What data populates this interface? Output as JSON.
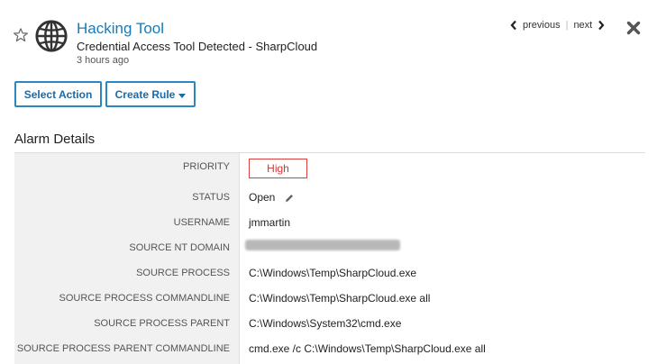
{
  "header": {
    "title": "Hacking Tool",
    "subtitle": "Credential Access Tool Detected - SharpCloud",
    "time_ago": "3 hours ago"
  },
  "nav": {
    "previous_label": "previous",
    "separator": "|",
    "next_label": "next"
  },
  "actions": {
    "select_action_label": "Select Action",
    "create_rule_label": "Create Rule"
  },
  "details": {
    "section_title": "Alarm Details",
    "priority_label": "PRIORITY",
    "priority_value": "High",
    "status_label": "STATUS",
    "status_value": "Open",
    "username_label": "USERNAME",
    "username_value": "jmmartin",
    "source_nt_domain_label": "SOURCE NT DOMAIN",
    "source_process_label": "SOURCE PROCESS",
    "source_process_value": "C:\\Windows\\Temp\\SharpCloud.exe",
    "source_process_cmdline_label": "SOURCE PROCESS COMMANDLINE",
    "source_process_cmdline_value": "C:\\Windows\\Temp\\SharpCloud.exe all",
    "source_process_parent_label": "SOURCE PROCESS PARENT",
    "source_process_parent_value": "C:\\Windows\\System32\\cmd.exe",
    "source_process_parent_cmdline_label": "SOURCE PROCESS PARENT COMMANDLINE",
    "source_process_parent_cmdline_value": "cmd.exe /c C:\\Windows\\Temp\\SharpCloud.exe all"
  },
  "icons": {
    "star": "star-outline-icon",
    "alarm_type": "globe-icon",
    "previous": "chevron-left-icon",
    "next": "chevron-right-icon",
    "close": "close-icon",
    "edit": "pencil-icon"
  },
  "colors": {
    "accent": "#1a7ab5",
    "priority_high": "#d63333",
    "label_column_bg": "#f1f1f1"
  }
}
